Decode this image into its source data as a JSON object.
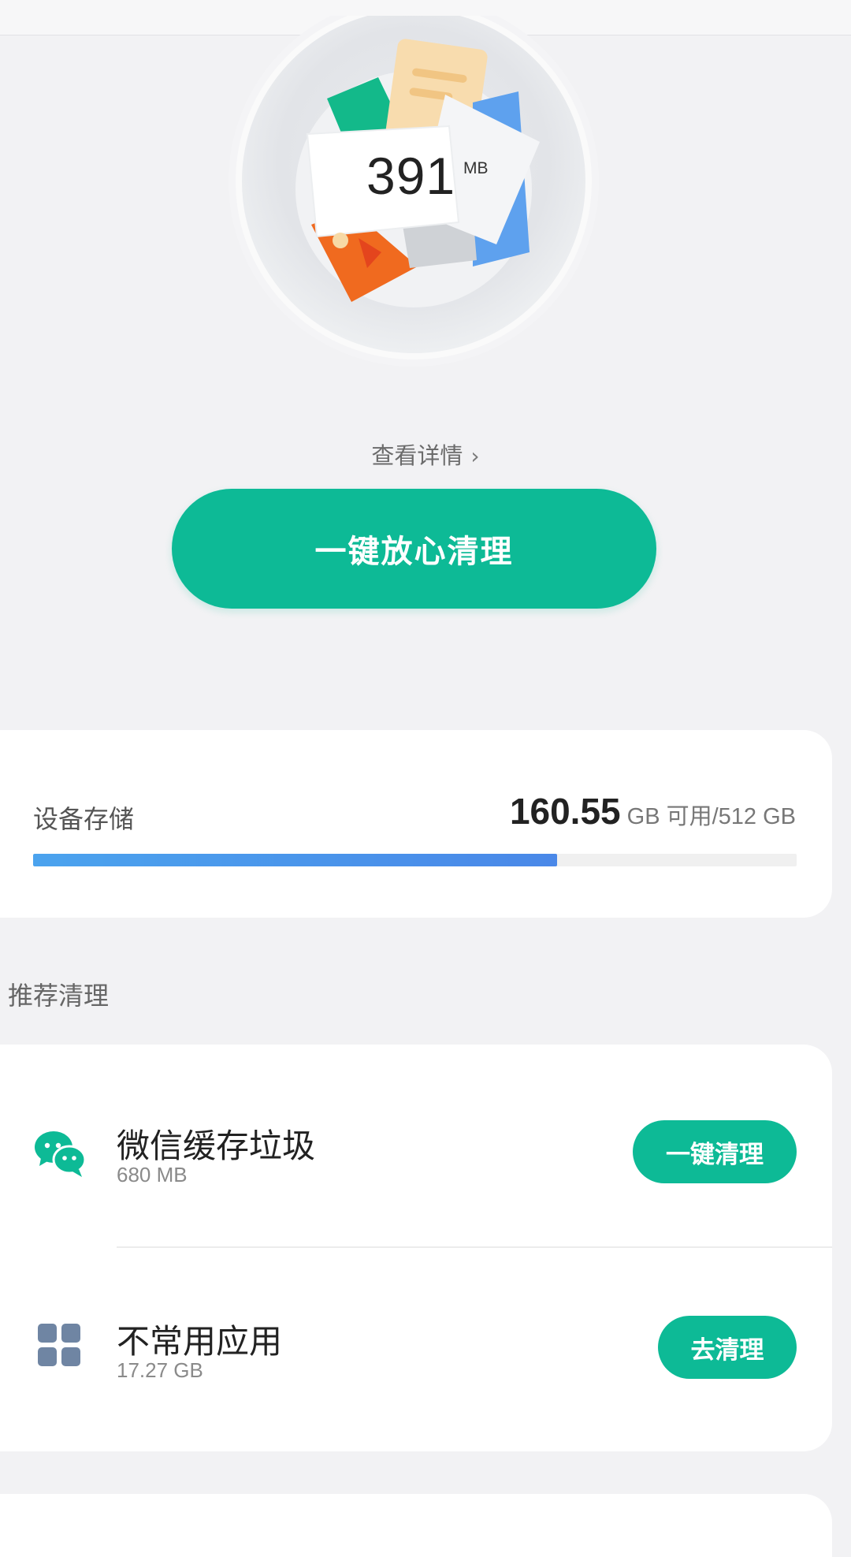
{
  "hero": {
    "value": "391",
    "unit": "MB"
  },
  "details_link": {
    "label": "查看详情",
    "chevron": "›"
  },
  "main_button": {
    "label": "一键放心清理"
  },
  "storage": {
    "label": "设备存储",
    "available_value": "160.55",
    "available_suffix": "GB 可用/512 GB",
    "used_fraction": 0.686,
    "bar_color": "#4a8fec"
  },
  "recommend": {
    "section_title": "推荐清理",
    "items": [
      {
        "icon": "wechat-icon",
        "title": "微信缓存垃圾",
        "size": "680 MB",
        "button": "一键清理"
      },
      {
        "icon": "apps-grid-icon",
        "title": "不常用应用",
        "size": "17.27 GB",
        "button": "去清理"
      }
    ]
  },
  "colors": {
    "accent": "#0dba96",
    "background": "#f2f2f4"
  }
}
